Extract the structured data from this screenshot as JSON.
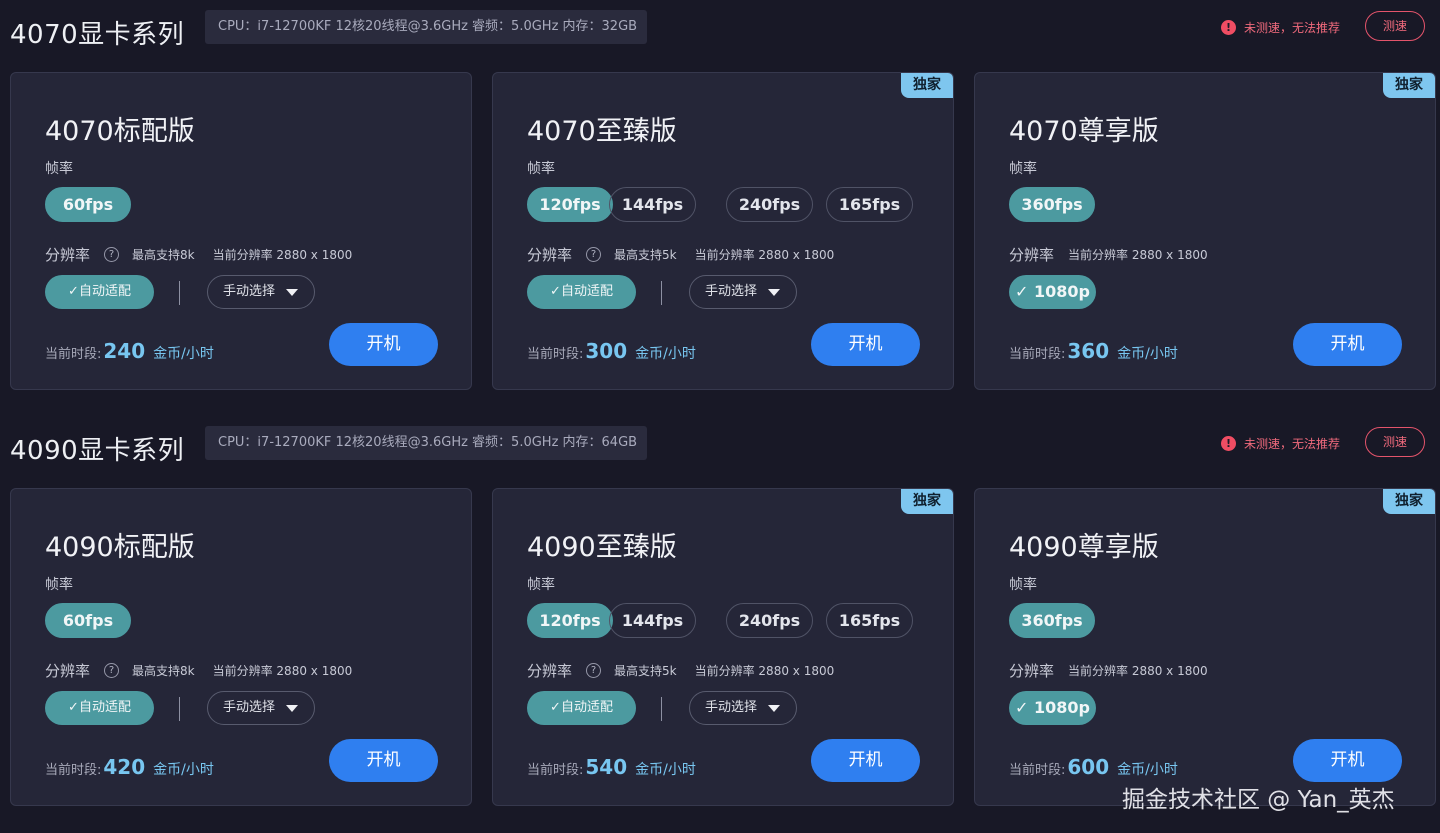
{
  "series": [
    {
      "title": "4070显卡系列",
      "spec": "CPU：i7-12700KF 12核20线程@3.6GHz 睿频：5.0GHz 内存：32GB",
      "warning": "未测速，无法推荐",
      "test_label": "测速",
      "cards": [
        {
          "name": "4070标配版",
          "exclusive": "",
          "fps_label": "帧率",
          "fps": [
            {
              "label": "60fps",
              "active": true
            }
          ],
          "res_label": "分辨率",
          "max_support": "最高支持8k",
          "current_res": "当前分辨率 2880 x 1800",
          "auto_label": "✓自动适配",
          "manual_label": "手动选择",
          "res_1080": "",
          "price_label": "当前时段:",
          "price": "240",
          "price_unit": "金币/小时",
          "boot_label": "开机"
        },
        {
          "name": "4070至臻版",
          "exclusive": "独家",
          "fps_label": "帧率",
          "fps": [
            {
              "label": "120fps",
              "active": true
            },
            {
              "label": "144fps",
              "active": false
            },
            {
              "label": "240fps",
              "active": false
            },
            {
              "label": "165fps",
              "active": false
            }
          ],
          "res_label": "分辨率",
          "max_support": "最高支持5k",
          "current_res": "当前分辨率 2880 x 1800",
          "auto_label": "✓自动适配",
          "manual_label": "手动选择",
          "res_1080": "",
          "price_label": "当前时段:",
          "price": "300",
          "price_unit": "金币/小时",
          "boot_label": "开机"
        },
        {
          "name": "4070尊享版",
          "exclusive": "独家",
          "fps_label": "帧率",
          "fps": [
            {
              "label": "360fps",
              "active": true
            }
          ],
          "res_label": "分辨率",
          "max_support": "",
          "current_res": "当前分辨率 2880 x 1800",
          "auto_label": "",
          "manual_label": "",
          "res_1080": "✓ 1080p",
          "price_label": "当前时段:",
          "price": "360",
          "price_unit": "金币/小时",
          "boot_label": "开机"
        }
      ]
    },
    {
      "title": "4090显卡系列",
      "spec": "CPU：i7-12700KF 12核20线程@3.6GHz 睿频：5.0GHz 内存：64GB",
      "warning": "未测速，无法推荐",
      "test_label": "测速",
      "cards": [
        {
          "name": "4090标配版",
          "exclusive": "",
          "fps_label": "帧率",
          "fps": [
            {
              "label": "60fps",
              "active": true
            }
          ],
          "res_label": "分辨率",
          "max_support": "最高支持8k",
          "current_res": "当前分辨率 2880 x 1800",
          "auto_label": "✓自动适配",
          "manual_label": "手动选择",
          "res_1080": "",
          "price_label": "当前时段:",
          "price": "420",
          "price_unit": "金币/小时",
          "boot_label": "开机"
        },
        {
          "name": "4090至臻版",
          "exclusive": "独家",
          "fps_label": "帧率",
          "fps": [
            {
              "label": "120fps",
              "active": true
            },
            {
              "label": "144fps",
              "active": false
            },
            {
              "label": "240fps",
              "active": false
            },
            {
              "label": "165fps",
              "active": false
            }
          ],
          "res_label": "分辨率",
          "max_support": "最高支持5k",
          "current_res": "当前分辨率 2880 x 1800",
          "auto_label": "✓自动适配",
          "manual_label": "手动选择",
          "res_1080": "",
          "price_label": "当前时段:",
          "price": "540",
          "price_unit": "金币/小时",
          "boot_label": "开机"
        },
        {
          "name": "4090尊享版",
          "exclusive": "独家",
          "fps_label": "帧率",
          "fps": [
            {
              "label": "360fps",
              "active": true
            }
          ],
          "res_label": "分辨率",
          "max_support": "",
          "current_res": "当前分辨率 2880 x 1800",
          "auto_label": "",
          "manual_label": "",
          "res_1080": "✓ 1080p",
          "price_label": "当前时段:",
          "price": "600",
          "price_unit": "金币/小时",
          "boot_label": "开机"
        }
      ]
    }
  ],
  "watermark": "掘金技术社区 @ Yan_英杰",
  "colors": {
    "background": "#181826",
    "card": "#252638",
    "accent_teal": "#4c9aa0",
    "primary_blue": "#2f7ff0",
    "warning_red": "#f06a7c",
    "exclusive_badge": "#7ec6ef"
  },
  "icons": {
    "warning": "exclamation-circle-icon",
    "help": "question-circle-icon",
    "dropdown": "caret-down-icon"
  }
}
